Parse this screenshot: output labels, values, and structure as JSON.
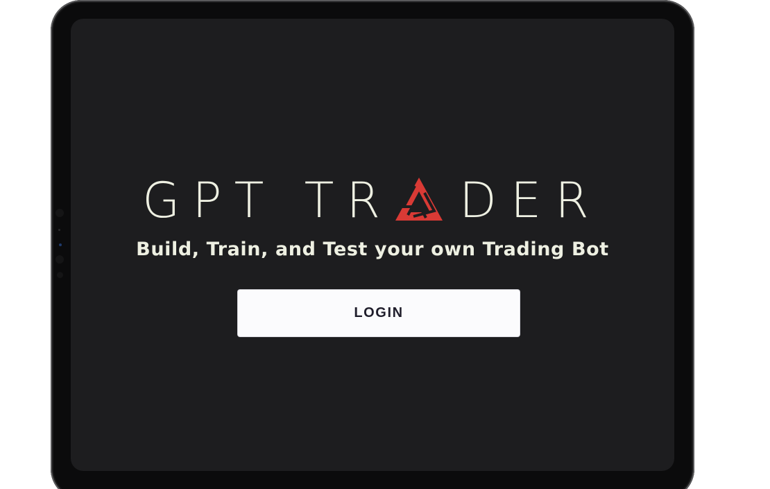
{
  "app": {
    "logo": {
      "text_before_mark": "GPT TR",
      "mark_icon": "triangle-logo-icon",
      "text_after_mark": "DER",
      "colors": {
        "text": "#eef0e2",
        "mark": "#d93a35"
      }
    },
    "tagline": "Build, Train, and Test your own Trading Bot",
    "login": {
      "label": "LOGIN"
    }
  },
  "colors": {
    "screen_background": "#1d1d1f",
    "device_frame": "#0b0b0c",
    "button_background": "#fbfbfd",
    "button_text": "#1f1d2b"
  }
}
